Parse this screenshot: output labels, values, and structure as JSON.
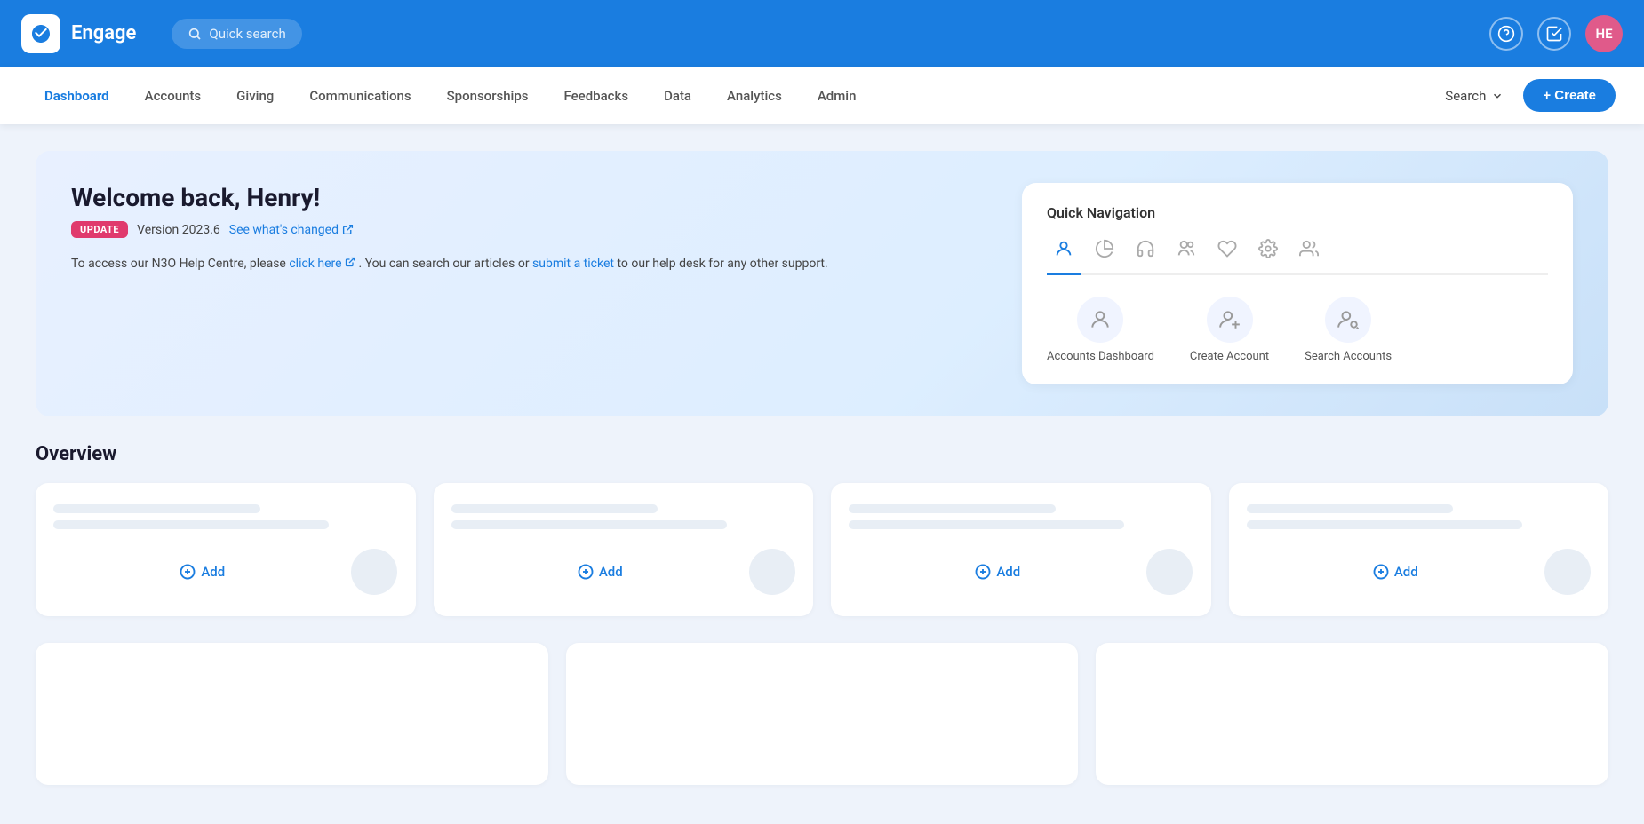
{
  "app": {
    "brand": "Engage",
    "logo_alt": "engage-logo"
  },
  "topbar": {
    "search_placeholder": "Quick search",
    "avatar_initials": "HE",
    "avatar_bg": "#e05a8a"
  },
  "navbar": {
    "items": [
      {
        "label": "Dashboard",
        "active": true,
        "key": "dashboard"
      },
      {
        "label": "Accounts",
        "active": false,
        "key": "accounts"
      },
      {
        "label": "Giving",
        "active": false,
        "key": "giving"
      },
      {
        "label": "Communications",
        "active": false,
        "key": "communications"
      },
      {
        "label": "Sponsorships",
        "active": false,
        "key": "sponsorships"
      },
      {
        "label": "Feedbacks",
        "active": false,
        "key": "feedbacks"
      },
      {
        "label": "Data",
        "active": false,
        "key": "data"
      },
      {
        "label": "Analytics",
        "active": false,
        "key": "analytics"
      },
      {
        "label": "Admin",
        "active": false,
        "key": "admin"
      }
    ],
    "search_label": "Search",
    "create_label": "+ Create"
  },
  "welcome": {
    "title": "Welcome back, Henry!",
    "update_badge": "UPDATE",
    "version_text": "Version 2023.6",
    "see_changes_label": "See what's changed",
    "help_text_prefix": "To access our N3O Help Centre, please",
    "click_here_label": "click here",
    "help_text_mid": ". You can search our articles or",
    "submit_ticket_label": "submit a ticket",
    "help_text_suffix": "to our help desk for any other support."
  },
  "quick_nav": {
    "title": "Quick Navigation",
    "tabs": [
      {
        "icon": "person",
        "active": true,
        "key": "accounts"
      },
      {
        "icon": "chart-pie",
        "active": false,
        "key": "giving"
      },
      {
        "icon": "headset",
        "active": false,
        "key": "communications"
      },
      {
        "icon": "people-connect",
        "active": false,
        "key": "sponsorships"
      },
      {
        "icon": "heart",
        "active": false,
        "key": "feedbacks"
      },
      {
        "icon": "gear",
        "active": false,
        "key": "settings"
      },
      {
        "icon": "people-group",
        "active": false,
        "key": "admin"
      }
    ],
    "items": [
      {
        "label": "Accounts Dashboard",
        "icon": "person",
        "key": "accounts-dashboard"
      },
      {
        "label": "Create Account",
        "icon": "person-add",
        "key": "create-account"
      },
      {
        "label": "Search Accounts",
        "icon": "person-search",
        "key": "search-accounts"
      }
    ]
  },
  "overview": {
    "title": "Overview",
    "cards": [
      {
        "add_label": "Add",
        "key": "card-1"
      },
      {
        "add_label": "Add",
        "key": "card-2"
      },
      {
        "add_label": "Add",
        "key": "card-3"
      },
      {
        "add_label": "Add",
        "key": "card-4"
      }
    ]
  },
  "lower_cards": [
    {
      "key": "lower-1"
    },
    {
      "key": "lower-2"
    },
    {
      "key": "lower-3"
    }
  ]
}
